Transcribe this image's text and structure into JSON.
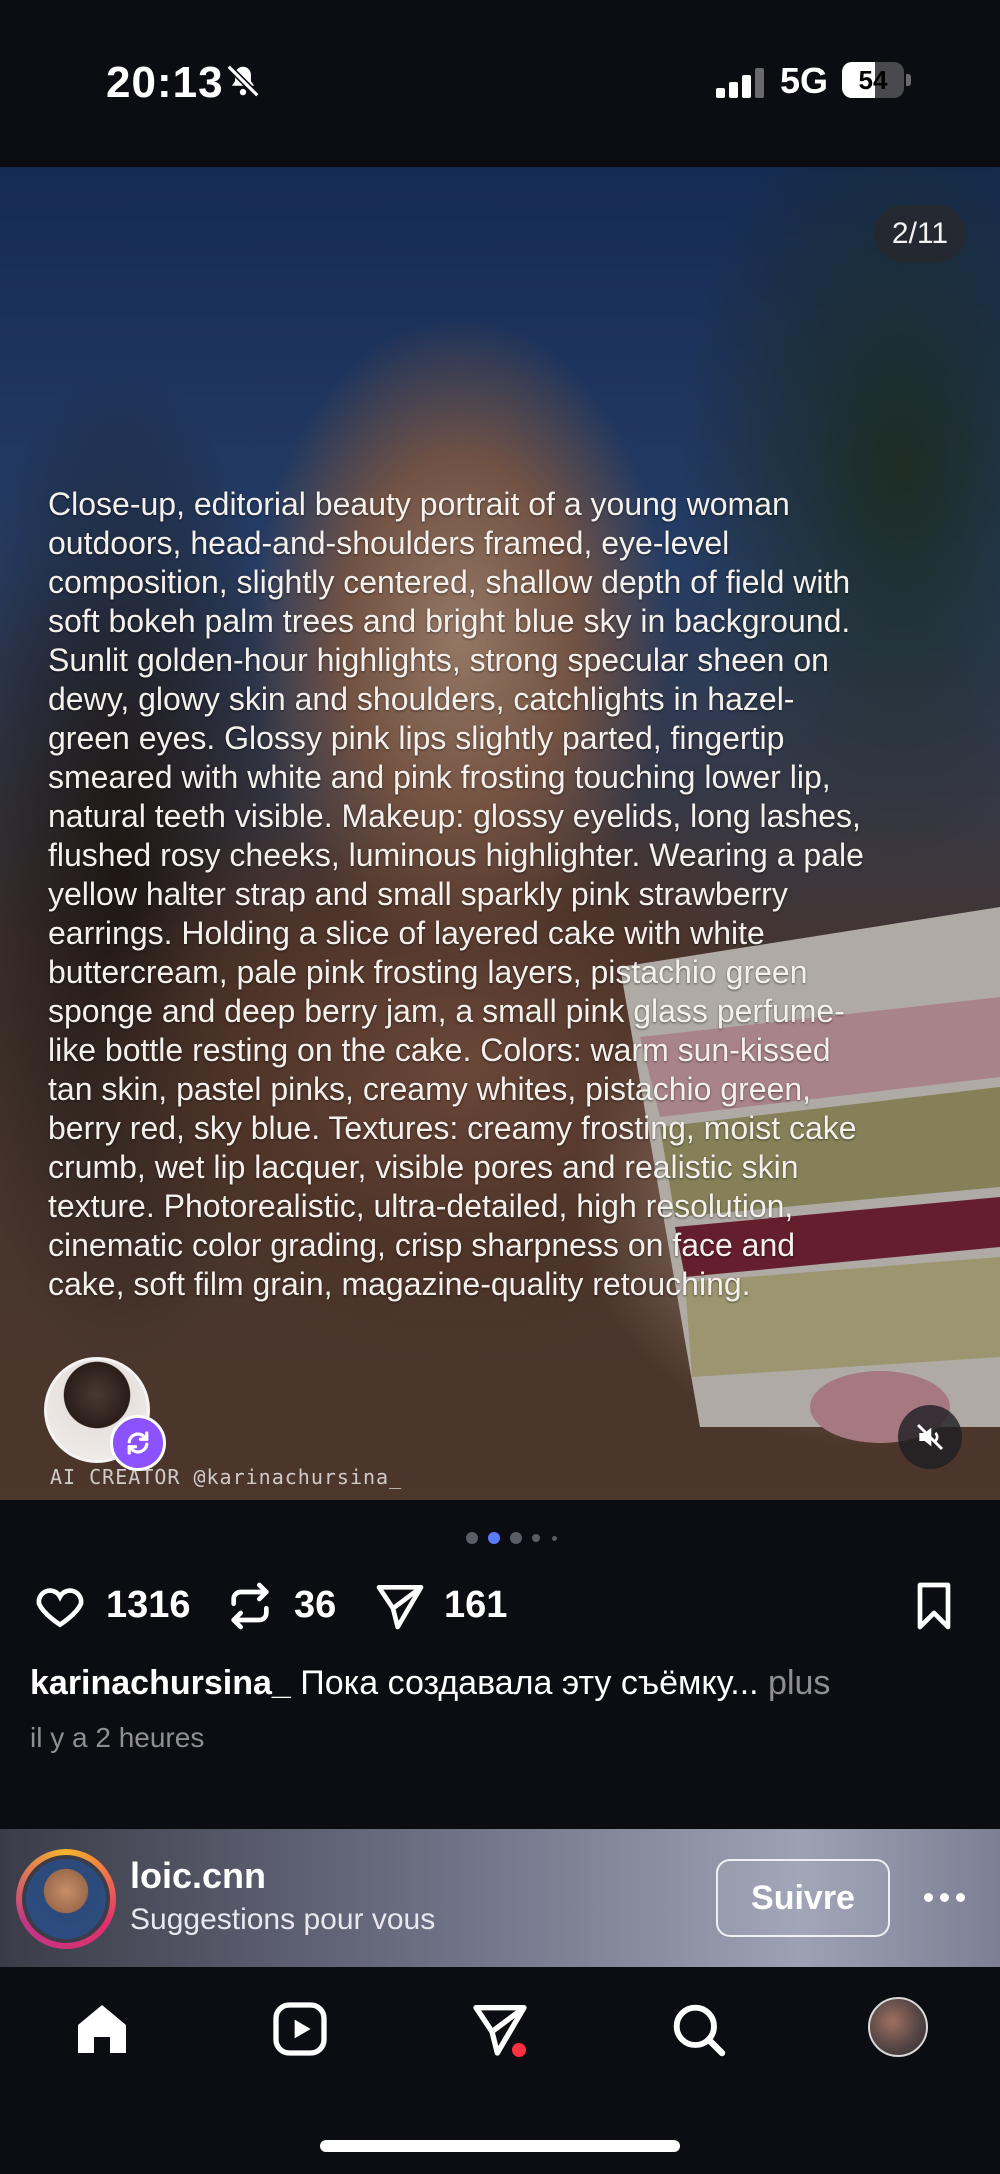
{
  "status_bar": {
    "time": "20:13",
    "network": "5G",
    "battery": "54",
    "battery_fraction": 0.54
  },
  "post": {
    "slide_counter": "2/11",
    "prompt_text": "Close-up, editorial beauty portrait of a young woman outdoors, head-and-shoulders framed, eye-level composition, slightly centered, shallow depth of field with soft bokeh palm trees and bright blue sky in background. Sunlit golden-hour highlights, strong specular sheen on dewy, glowy skin and shoulders, catchlights in hazel-green eyes. Glossy pink lips slightly parted, fingertip smeared with white and pink frosting touching lower lip, natural teeth visible. Makeup: glossy eyelids, long lashes, flushed rosy cheeks, luminous highlighter. Wearing a pale yellow halter strap and small sparkly pink strawberry earrings. Holding a slice of layered cake with white buttercream, pale pink frosting layers, pistachio green sponge and deep berry jam, a small pink glass perfume-like bottle resting on the cake. Colors: warm sun-kissed tan skin, pastel pinks, creamy whites, pistachio green, berry red, sky blue. Textures: creamy frosting, moist cake crumb, wet lip lacquer, visible pores and realistic skin texture. Photorealistic, ultra-detailed, high resolution, cinematic color grading, crisp sharpness on face and cake, soft film grain, magazine-quality retouching.",
    "creator_credit": "AI CREATOR @karinachursina_",
    "active_slide_index": 1,
    "likes": "1316",
    "reposts": "36",
    "shares": "161",
    "caption_user": "karinachursina_",
    "caption_text": "Пока создавала эту съёмку...",
    "caption_more": "plus",
    "timestamp": "il y a 2 heures"
  },
  "suggestion": {
    "username": "loic.cnn",
    "subtitle": "Suggestions pour vous",
    "follow_label": "Suivre"
  },
  "nav": {
    "items": [
      "home-icon",
      "reels-icon",
      "messages-icon",
      "search-icon",
      "profile-avatar"
    ]
  },
  "colors": {
    "background": "#0c0d12",
    "remix_badge": "#8c52ff",
    "notification_dot": "#ff3040",
    "active_page_dot": "#5b7cff",
    "muted_text": "#8e8e93"
  }
}
